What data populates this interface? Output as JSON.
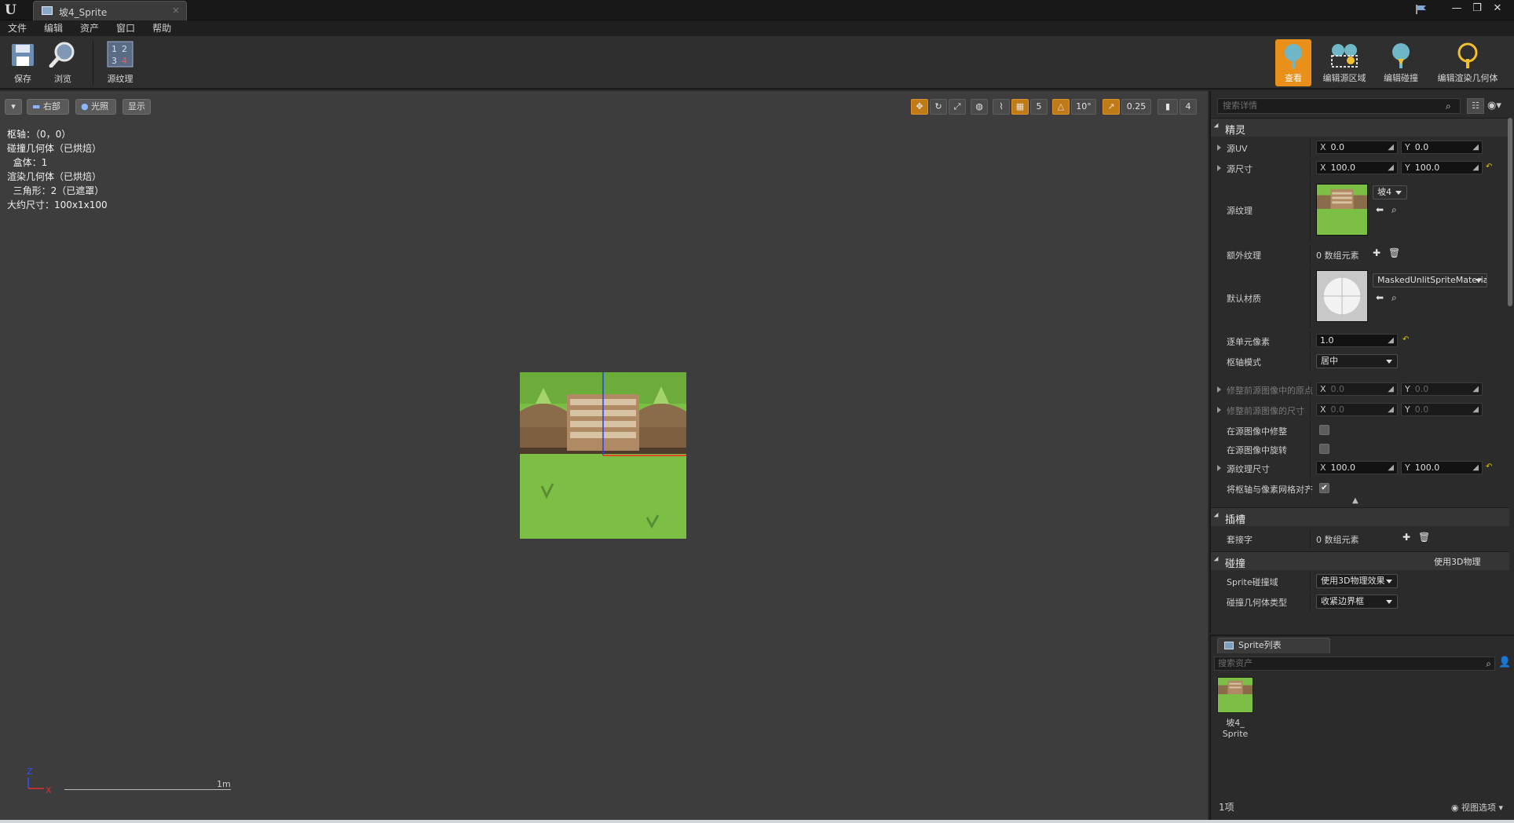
{
  "window": {
    "tab_title": "坡4_Sprite",
    "tab_close": "×",
    "controls": [
      "—",
      "❐",
      "✕"
    ]
  },
  "menu": [
    "文件",
    "编辑",
    "资产",
    "窗口",
    "帮助"
  ],
  "toolbar": {
    "save": "保存",
    "browse": "浏览",
    "source_texture": "源纹理",
    "modes": [
      "查看",
      "编辑源区域",
      "编辑碰撞",
      "编辑渲染几何体"
    ]
  },
  "viewport": {
    "menu_arrow": "▾",
    "view_label": "右部",
    "lit_label": "光照",
    "show_label": "显示",
    "grid_snap": "5",
    "rot_snap": "10°",
    "scale_snap": "0.25",
    "cam_speed": "4",
    "stats": [
      "枢轴：（0，0）",
      "碰撞几何体（已烘焙）",
      "  盒体：1",
      "渲染几何体（已烘焙）",
      "  三角形：2（已遮罩）",
      "大约尺寸：100x1x100"
    ],
    "axis_z": "Z",
    "axis_x": "X",
    "scale_label": "1m"
  },
  "details": {
    "search_placeholder": "搜索详情",
    "cat_sprite": "精灵",
    "rows": {
      "source_uv": {
        "label": "源UV",
        "x": "0.0",
        "y": "0.0"
      },
      "source_dim": {
        "label": "源尺寸",
        "x": "100.0",
        "y": "100.0"
      },
      "source_tex": {
        "label": "源纹理",
        "value": "坡4"
      },
      "extra_tex": {
        "label": "额外纹理",
        "value": "0 数组元素"
      },
      "default_mat": {
        "label": "默认材质",
        "value": "MaskedUnlitSpriteMateria"
      },
      "ppu": {
        "label": "逐单元像素",
        "value": "1.0"
      },
      "pivot": {
        "label": "枢轴模式",
        "value": "居中"
      },
      "trim_origin": {
        "label": "修整前源图像中的原点",
        "x": "0.0",
        "y": "0.0"
      },
      "trim_size": {
        "label": "修整前源图像的尺寸",
        "x": "0.0",
        "y": "0.0"
      },
      "trimmed": {
        "label": "在源图像中修整"
      },
      "rotated": {
        "label": "在源图像中旋转"
      },
      "tex_dim": {
        "label": "源纹理尺寸",
        "x": "100.0",
        "y": "100.0"
      },
      "snap_pivot": {
        "label": "将枢轴与像素网格对齐"
      }
    },
    "cat_sockets": "插槽",
    "sockets": {
      "label": "套接字",
      "value": "0 数组元素"
    },
    "cat_collision": "碰撞",
    "collision_note": "使用3D物理",
    "collision_domain": {
      "label": "Sprite碰撞域",
      "value": "使用3D物理效果"
    },
    "collision_geo": {
      "label": "碰撞几何体类型",
      "value": "收紧边界框"
    }
  },
  "spritelist": {
    "tab": "Sprite列表",
    "search_placeholder": "搜索资产",
    "asset_name": "坡4_\nSprite",
    "count": "1项",
    "view_options": "视图选项"
  },
  "colors": {
    "accent": "#e8901a",
    "grass": "#7bc044",
    "dirt": "#8a6b4a"
  }
}
